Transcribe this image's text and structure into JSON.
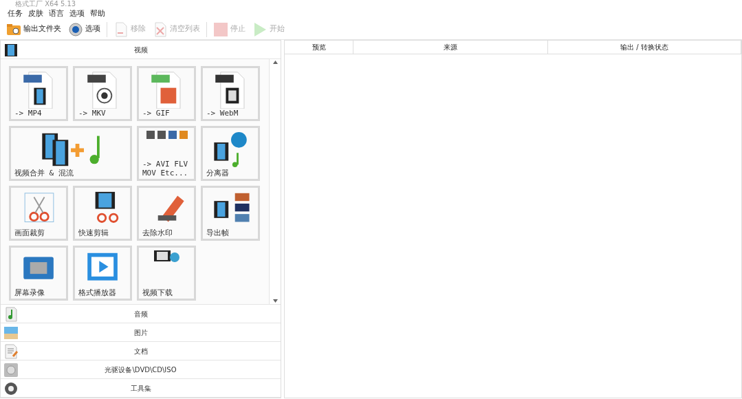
{
  "window": {
    "title": "格式工厂 X64 5.13"
  },
  "menu": [
    "任务",
    "皮肤",
    "语言",
    "选项",
    "帮助"
  ],
  "toolbar": [
    {
      "label": "输出文件夹",
      "disabled": false
    },
    {
      "label": "选项",
      "disabled": false
    },
    {
      "label": "移除",
      "disabled": true
    },
    {
      "label": "清空列表",
      "disabled": true
    },
    {
      "label": "停止",
      "disabled": true
    },
    {
      "label": "开始",
      "disabled": true
    }
  ],
  "categories": [
    {
      "label": "视频",
      "tiles": [
        {
          "label": "-> MP4",
          "wide": false
        },
        {
          "label": "-> MKV",
          "wide": false
        },
        {
          "label": "-> GIF",
          "wide": false
        },
        {
          "label": "-> WebM",
          "wide": false
        },
        {
          "label": "视频合并 & 混流",
          "wide": true
        },
        {
          "label": "-> AVI FLV MOV Etc...",
          "wide": false
        },
        {
          "label": "分离器",
          "wide": false
        },
        {
          "label": "画面裁剪",
          "wide": false
        },
        {
          "label": "快速剪辑",
          "wide": false
        },
        {
          "label": "去除水印",
          "wide": false
        },
        {
          "label": "导出帧",
          "wide": false
        },
        {
          "label": "屏幕录像",
          "wide": false
        },
        {
          "label": "格式播放器",
          "wide": false
        },
        {
          "label": "视频下载",
          "wide": false
        }
      ]
    },
    {
      "label": "音频"
    },
    {
      "label": "图片"
    },
    {
      "label": "文档"
    },
    {
      "label": "光驱设备\\DVD\\CD\\ISO"
    },
    {
      "label": "工具集"
    }
  ],
  "table": {
    "columns": [
      "预览",
      "来源",
      "输出 / 转换状态"
    ]
  }
}
